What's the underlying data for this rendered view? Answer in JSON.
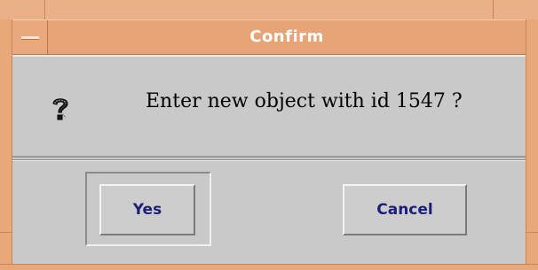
{
  "window": {
    "title": "Confirm",
    "frame_color": "#e8a878",
    "body_color": "#c9c9c9"
  },
  "titlebar": {
    "menu_icon": "window-menu-dash-icon"
  },
  "dialog": {
    "icon": "question-mark-icon",
    "message": "Enter new object with id 1547 ?"
  },
  "buttons": {
    "yes_label": "Yes",
    "cancel_label": "Cancel",
    "default": "Yes",
    "label_color": "#1d1d7a"
  }
}
